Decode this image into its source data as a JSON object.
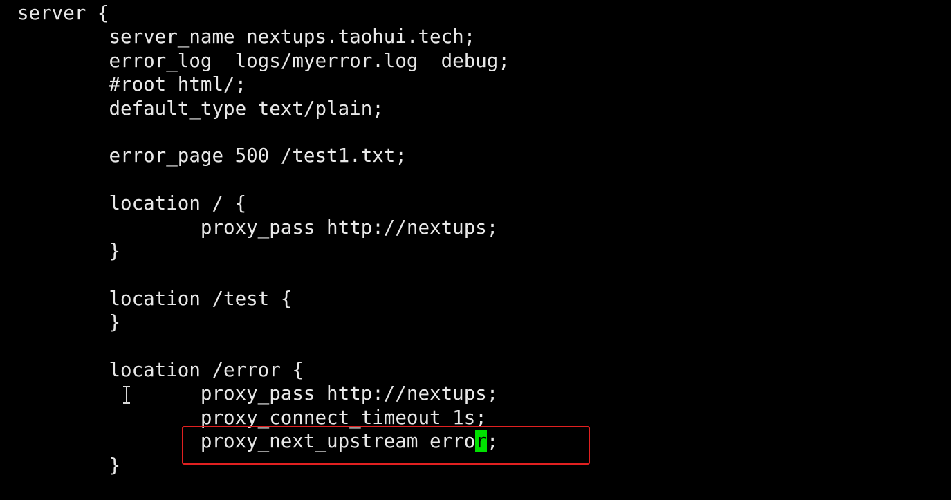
{
  "terminal": {
    "lines": {
      "l0": "server {",
      "l1": "        server_name nextups.taohui.tech;",
      "l2": "        error_log  logs/myerror.log  debug;",
      "l3": "        #root html/;",
      "l4": "        default_type text/plain;",
      "l6": "        error_page 500 /test1.txt;",
      "l8": "        location / {",
      "l9": "                proxy_pass http://nextups;",
      "l10": "        }",
      "l12": "        location /test {",
      "l13": "        }",
      "l15": "        location /error {",
      "l16": "                proxy_pass http://nextups;",
      "l17": "                proxy_connect_timeout 1s;",
      "l18_before": "                proxy_next_upstream erro",
      "l18_cursor": "r",
      "l18_after": ";",
      "l19": "        }"
    }
  },
  "colors": {
    "background": "#000000",
    "text": "#e8e8e8",
    "cursor": "#00e000",
    "highlight_box": "#e02020"
  },
  "icons": {
    "mouse_pointer": "i-beam-cursor-icon"
  }
}
